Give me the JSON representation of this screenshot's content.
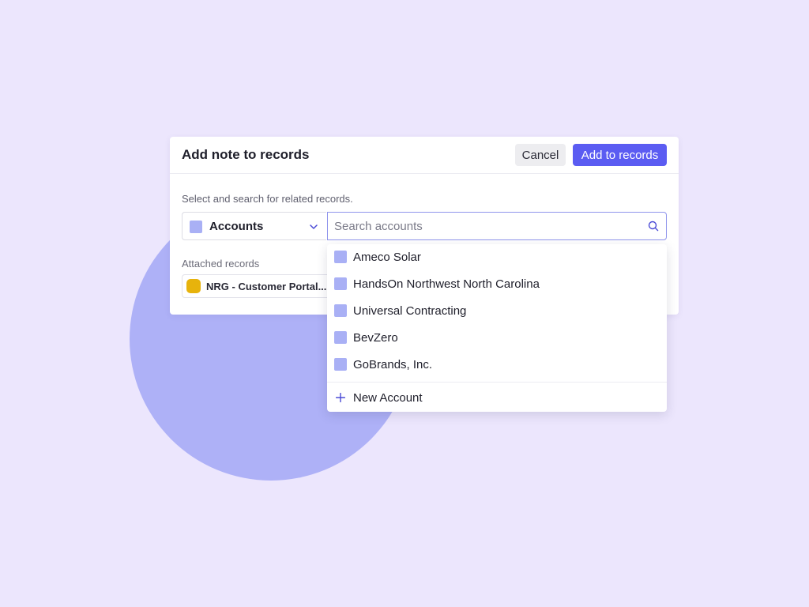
{
  "modal": {
    "title": "Add note to records",
    "cancel_label": "Cancel",
    "add_label": "Add to records",
    "helper_text": "Select and search for related records.",
    "record_type": {
      "label": "Accounts",
      "icon": "chevron-down-icon"
    },
    "search": {
      "placeholder": "Search accounts",
      "value": "",
      "icon": "search-icon"
    },
    "attached": {
      "label": "Attached records",
      "records": [
        {
          "label": "NRG - Customer Portal..."
        }
      ]
    }
  },
  "dropdown": {
    "items": [
      {
        "label": "Ameco Solar"
      },
      {
        "label": "HandsOn Northwest North Carolina"
      },
      {
        "label": "Universal Contracting"
      },
      {
        "label": "BevZero"
      },
      {
        "label": "GoBrands, Inc."
      }
    ],
    "new_label": "New Account",
    "new_icon": "plus-icon"
  },
  "colors": {
    "background": "#ece6fd",
    "accent": "#5b5cf2",
    "account_swatch": "#a9b0f5",
    "record_swatch": "#e7b30c",
    "circle": "#aeb1f7"
  }
}
